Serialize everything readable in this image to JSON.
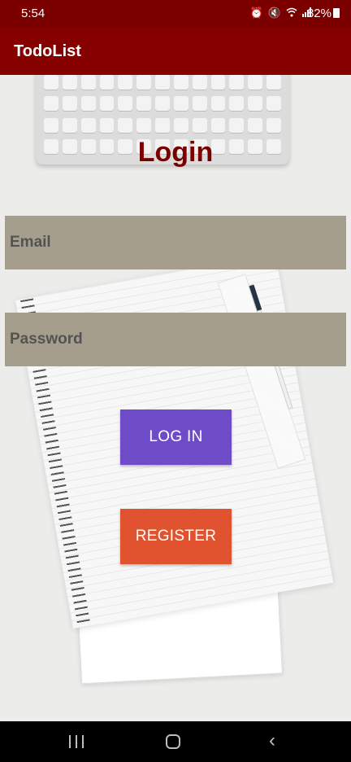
{
  "status_bar": {
    "time": "5:54",
    "battery_percent": "82%",
    "icons": [
      "alarm-icon",
      "mute-icon",
      "wifi-icon",
      "signal-icon",
      "battery-icon"
    ]
  },
  "app_bar": {
    "title": "TodoList"
  },
  "login": {
    "title": "Login",
    "email_placeholder": "Email",
    "password_placeholder": "Password",
    "login_button": "LOG IN",
    "register_button": "REGISTER"
  },
  "colors": {
    "app_bar": "#870000",
    "title": "#7a0000",
    "input_bg": "#a59e8c",
    "login_button": "#6e4cc7",
    "register_button": "#e0532e"
  },
  "nav_bar": {
    "icons": [
      "recents-icon",
      "home-icon",
      "back-icon"
    ]
  }
}
